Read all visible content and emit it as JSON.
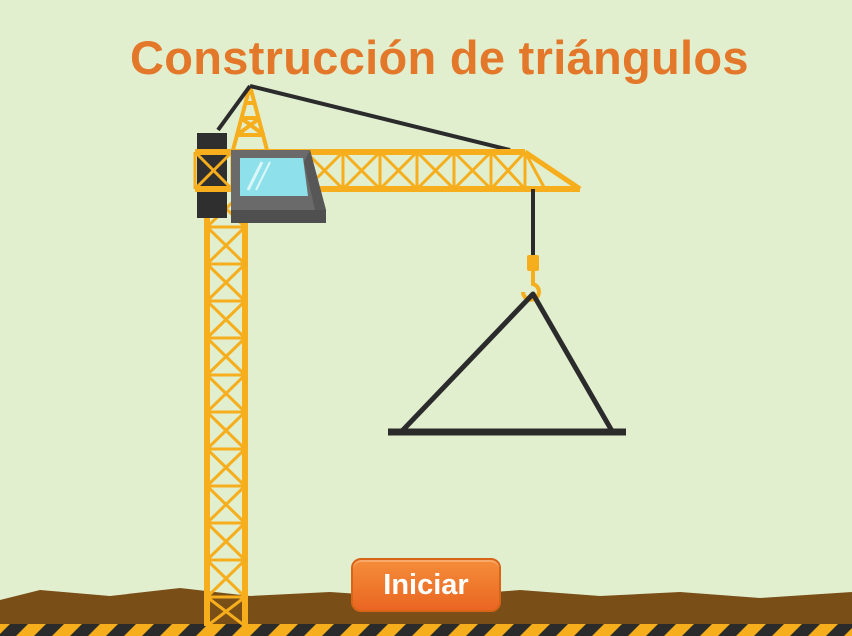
{
  "title": "Construcción de triángulos",
  "start_button": {
    "label": "Iniciar"
  },
  "colors": {
    "background": "#e1efcf",
    "title": "#e3782a",
    "crane": "#f6ae1c",
    "cable": "#2b2b2b",
    "ground": "#7a4e17",
    "stripe_dark": "#2b2b2b",
    "stripe_light": "#f6ae1c",
    "button": "#f07a2c",
    "cab_glass": "#8ee0ea",
    "cab_body": "#6a6a6a"
  },
  "icons": {
    "crane": "tower-crane-icon",
    "triangle": "triangle-frame-icon",
    "hook": "crane-hook-icon"
  }
}
